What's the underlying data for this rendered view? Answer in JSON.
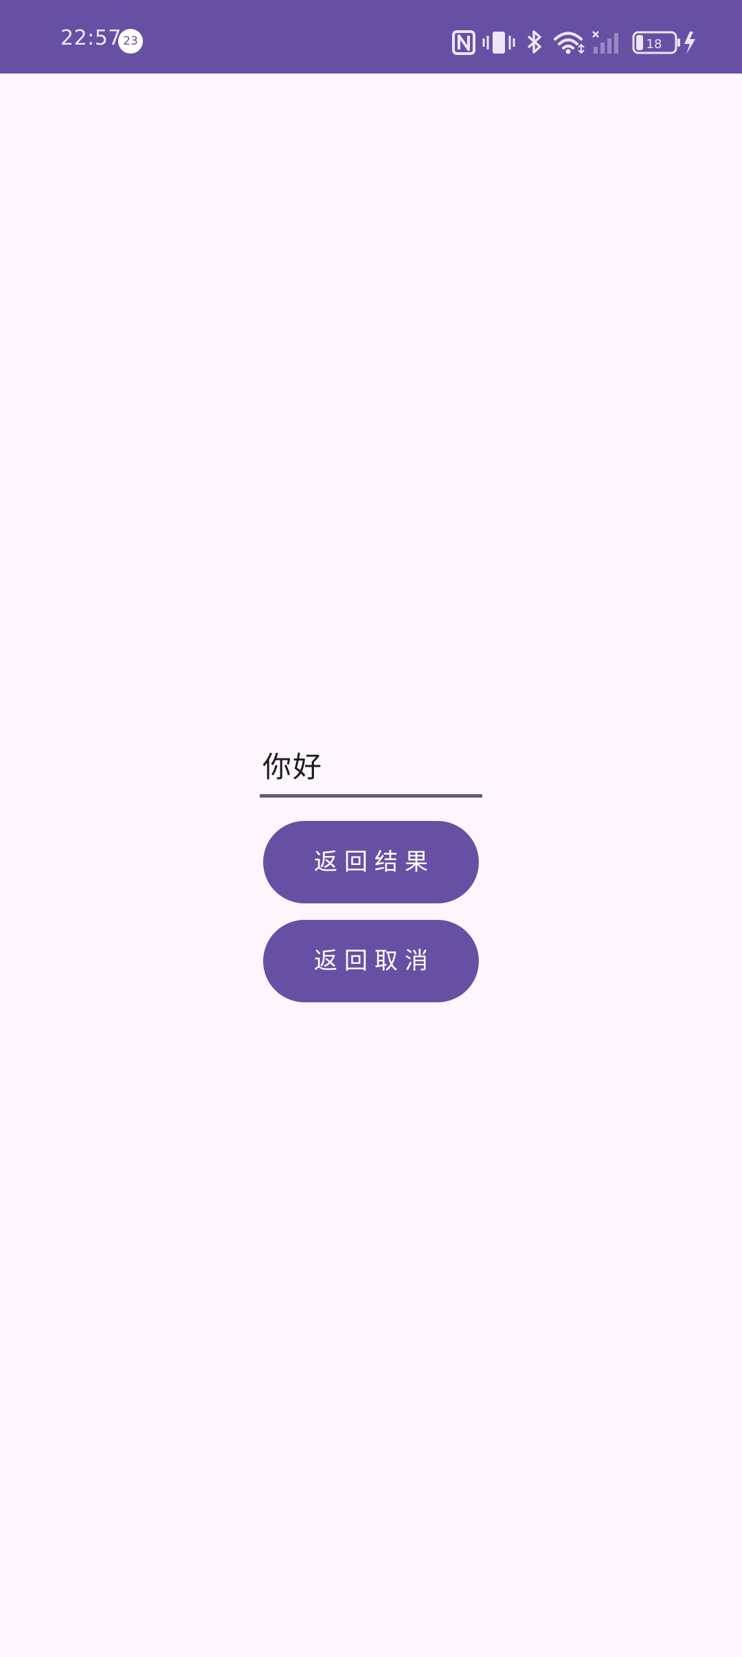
{
  "status_bar": {
    "time": "22:57",
    "notification_count": "23",
    "battery_level": "18",
    "background_color": "#6750a4",
    "icons": [
      "nfc-icon",
      "vibrate-icon",
      "bluetooth-icon",
      "wifi-icon",
      "signal-no-service-icon",
      "battery-icon",
      "charging-icon"
    ]
  },
  "form": {
    "input_value": "你好",
    "return_result_label": "返回结果",
    "return_cancel_label": "返回取消"
  },
  "colors": {
    "primary": "#6750a4",
    "background": "#fdf7fd",
    "underline": "#625b71",
    "on_primary": "#ffffff"
  }
}
